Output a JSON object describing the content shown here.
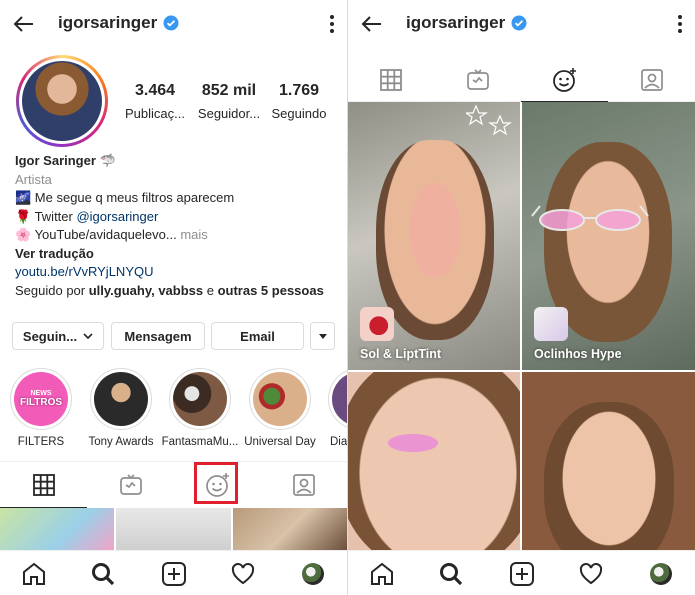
{
  "left": {
    "header": {
      "username": "igorsaringer"
    },
    "stats": [
      {
        "value": "3.464",
        "label": "Publicaç..."
      },
      {
        "value": "852 mil",
        "label": "Seguidor..."
      },
      {
        "value": "1.769",
        "label": "Seguindo"
      }
    ],
    "bio": {
      "name": "Igor Saringer",
      "name_emoji": "🦈",
      "category": "Artista",
      "line1": "🌌 Me segue q meus filtros aparecem",
      "line2_prefix": "🌹 Twitter ",
      "line2_handle": "@igorsaringer",
      "line3": "🌸 YouTube/avidaquelevo...",
      "line3_more": " mais",
      "translate": "Ver tradução",
      "link": "youtu.be/rVvRYjLNYQU",
      "followed_prefix": "Seguido por ",
      "followed_users": "ully.guahy, vabbss",
      "followed_mid": " e ",
      "followed_others": "outras 5 pessoas"
    },
    "buttons": {
      "following": "Seguin...",
      "message": "Mensagem",
      "email": "Email"
    },
    "highlights": [
      {
        "label": "FILTERS",
        "cover_text_top": "NEWS",
        "cover_text": "FILTROS"
      },
      {
        "label": "Tony Awards"
      },
      {
        "label": "FantasmaMu..."
      },
      {
        "label": "Universal Day"
      },
      {
        "label": "Dia"
      }
    ]
  },
  "right": {
    "header": {
      "username": "igorsaringer"
    },
    "effects": [
      {
        "name": "Sol & LiptTint"
      },
      {
        "name": "Oclinhos Hype"
      }
    ]
  },
  "colors": {
    "verified": "#3897f0",
    "link": "#003569",
    "muted": "#8e8e8e",
    "highlight_box": "#e0202e",
    "filters_pink": "#f25bb8"
  },
  "icons": [
    "back-arrow-icon",
    "verified-icon",
    "more-vertical-icon",
    "grid-icon",
    "igtv-icon",
    "effects-icon",
    "tagged-icon",
    "home-icon",
    "search-icon",
    "add-icon",
    "heart-icon",
    "profile-avatar-icon",
    "dropdown-chevron-icon"
  ]
}
